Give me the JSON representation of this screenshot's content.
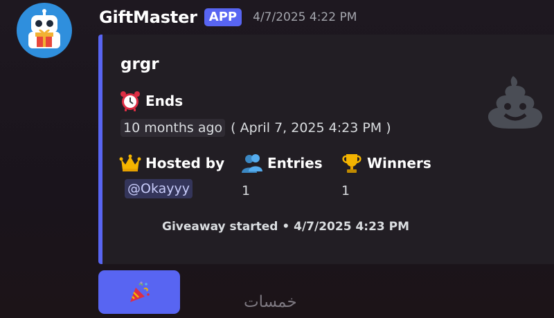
{
  "message": {
    "author": "GiftMaster",
    "badge": "APP",
    "timestamp": "4/7/2025 4:22 PM"
  },
  "embed": {
    "title": "grgr",
    "ends": {
      "label": "Ends",
      "relative": "10 months ago",
      "absolute": "( April 7, 2025 4:23 PM )"
    },
    "fields": [
      {
        "name": "Hosted by",
        "value": "@Okayyy",
        "icon": "crown-icon"
      },
      {
        "name": "Entries",
        "value": "1",
        "icon": "people-icon"
      },
      {
        "name": "Winners",
        "value": "1",
        "icon": "trophy-icon"
      }
    ],
    "footer": "Giveaway started • 4/7/2025 4:23 PM",
    "accent_color": "#5865f2",
    "thumbnail_icon": "pile-of-poo-icon"
  },
  "button": {
    "icon": "party-popper-icon",
    "color": "#5865f2"
  },
  "watermark": "خمسات"
}
